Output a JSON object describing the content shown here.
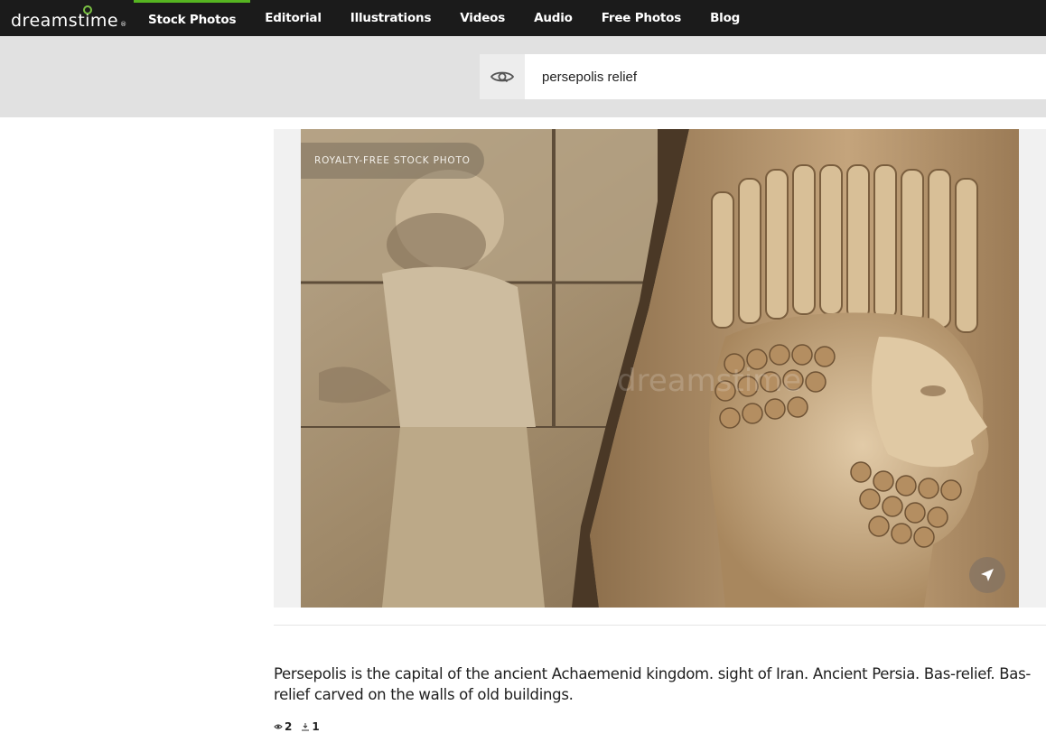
{
  "brand": {
    "name": "dreamstime",
    "registered": "®"
  },
  "nav": {
    "items": [
      {
        "label": "Stock Photos",
        "active": true
      },
      {
        "label": "Editorial"
      },
      {
        "label": "Illustrations"
      },
      {
        "label": "Videos"
      },
      {
        "label": "Audio"
      },
      {
        "label": "Free Photos"
      },
      {
        "label": "Blog"
      }
    ]
  },
  "search": {
    "value": "persepolis relief",
    "icon": "eye-icon"
  },
  "photo": {
    "badge": "ROYALTY-FREE STOCK PHOTO",
    "share_icon": "paper-plane-icon",
    "description": "Persepolis is the capital of the ancient Achaemenid kingdom. sight of Iran. Ancient Persia. Bas-relief. Bas-relief carved on the walls of old buildings."
  },
  "stats": {
    "views": "2",
    "downloads": "1"
  },
  "colors": {
    "topbar": "#1b1b1b",
    "accent": "#56b421",
    "searchband": "#e1e1e1"
  }
}
